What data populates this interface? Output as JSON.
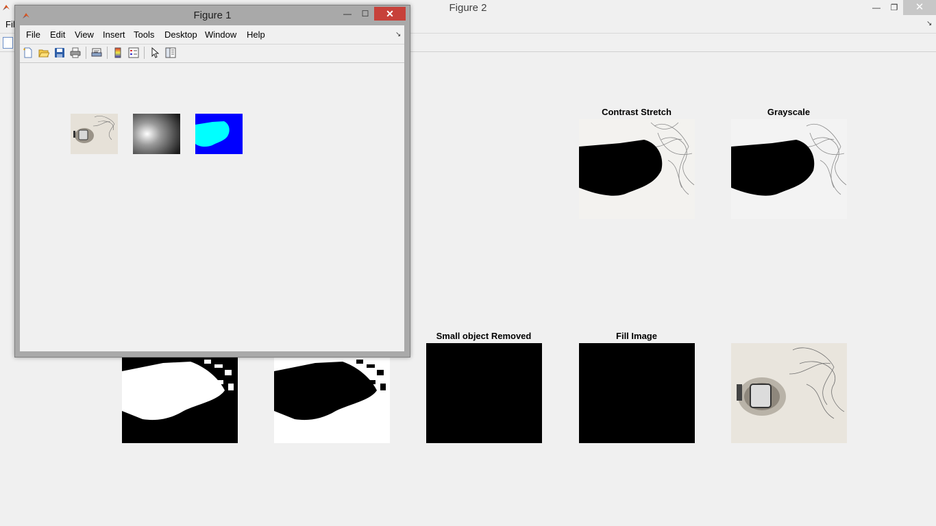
{
  "figure2": {
    "title": "Figure 2",
    "menu_file": "Fil",
    "axes_titles": {
      "contrast": "Contrast Stretch",
      "grayscale": "Grayscale",
      "small_removed": "Small object Removed",
      "fill": "Fill Image"
    }
  },
  "figure1": {
    "title": "Figure 1",
    "menu": [
      "File",
      "Edit",
      "View",
      "Insert",
      "Tools",
      "Desktop",
      "Window",
      "Help"
    ]
  },
  "window_controls": {
    "minimize": "—",
    "maximize": "☐",
    "restore": "❐",
    "close": "✕",
    "menu_dock": "↘"
  },
  "colors": {
    "close_active": "#c7413a",
    "mask_cyan": "#00ffff",
    "mask_blue": "#0000ff"
  },
  "icons": [
    "new-figure-icon",
    "open-file-icon",
    "save-icon",
    "print-icon",
    "print-preview-icon",
    "colorbar-icon",
    "legend-icon",
    "pointer-icon",
    "property-inspector-icon"
  ]
}
